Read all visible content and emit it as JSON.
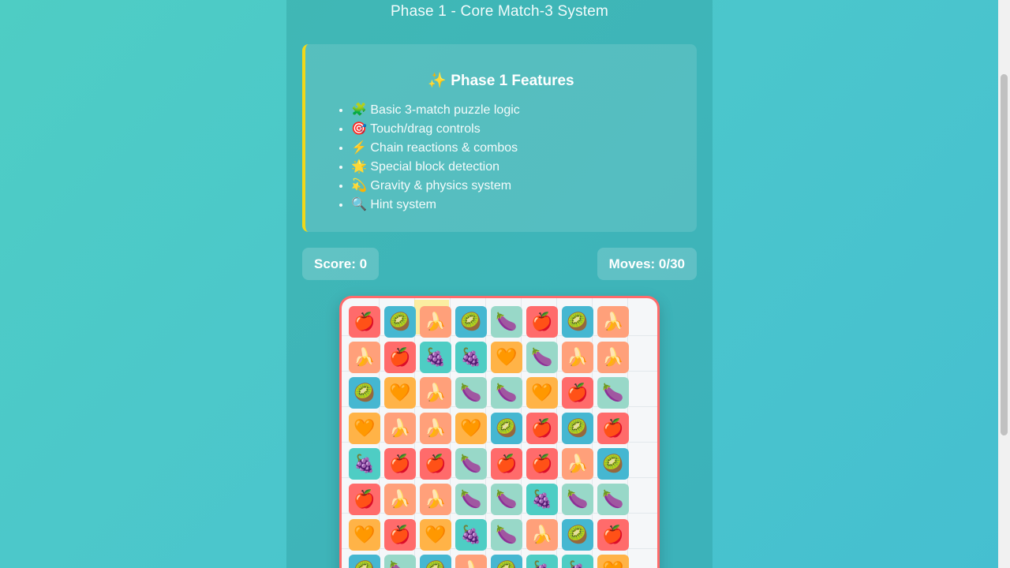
{
  "header": {
    "subtitle": "Phase 1 - Core Match-3 System"
  },
  "features": {
    "title": "✨ Phase 1 Features",
    "items": [
      "🧩 Basic 3-match puzzle logic",
      "🎯 Touch/drag controls",
      "⚡ Chain reactions & combos",
      "🌟 Special block detection",
      "💫 Gravity & physics system",
      "🔍 Hint system"
    ]
  },
  "stats": {
    "score": "Score: 0",
    "moves": "Moves: 0/30"
  },
  "board": {
    "rows": [
      [
        "apple",
        "kiwi",
        "banana",
        "kiwi",
        "eggplant",
        "apple",
        "kiwi",
        "banana"
      ],
      [
        "banana",
        "apple",
        "grape",
        "grape",
        "heart",
        "eggplant",
        "banana",
        "banana"
      ],
      [
        "kiwi",
        "heart",
        "banana",
        "eggplant",
        "eggplant",
        "heart",
        "apple",
        "eggplant"
      ],
      [
        "heart",
        "banana",
        "banana",
        "heart",
        "kiwi",
        "apple",
        "kiwi",
        "apple"
      ],
      [
        "grape",
        "apple",
        "apple",
        "eggplant",
        "apple",
        "apple",
        "banana",
        "kiwi"
      ],
      [
        "apple",
        "banana",
        "banana",
        "eggplant",
        "eggplant",
        "grape",
        "eggplant",
        "eggplant"
      ],
      [
        "heart",
        "apple",
        "heart",
        "grape",
        "eggplant",
        "banana",
        "kiwi",
        "apple"
      ],
      [
        "kiwi",
        "eggplant",
        "kiwi",
        "banana",
        "kiwi",
        "grape",
        "grape",
        "heart"
      ]
    ],
    "highlighted_cell": [
      0,
      2
    ],
    "icons": {
      "apple": "🍎",
      "kiwi": "🥝",
      "banana": "🍌",
      "eggplant": "🍆",
      "grape": "🍇",
      "heart": "🧡"
    }
  }
}
